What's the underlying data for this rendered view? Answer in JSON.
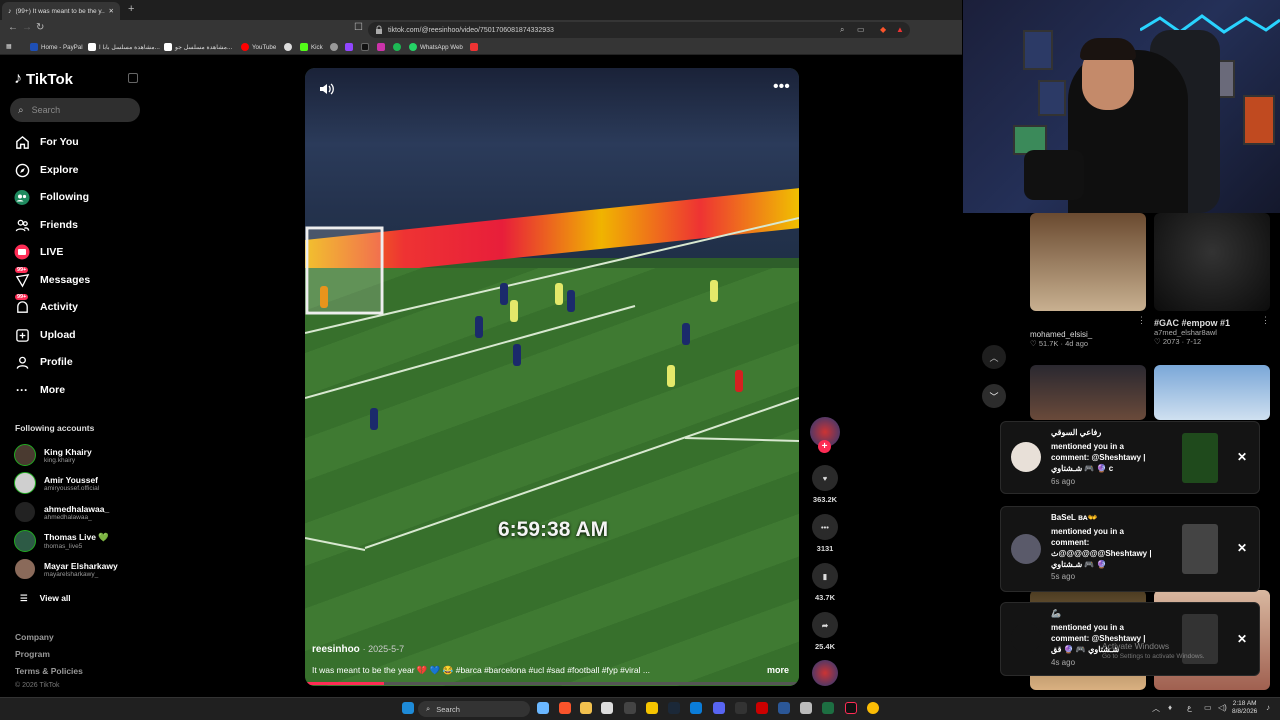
{
  "browser": {
    "tab_title": "(99+) It was meant to be the y...",
    "new_tab": "+",
    "url": "tiktok.com/@reesinhoo/video/7501706081874332933",
    "bookmarks": [
      {
        "label": "Home - PayPal",
        "color": "#1e4fb5"
      },
      {
        "label": "مشاهدة مسلسل بابا ا...",
        "color": "#ffffff"
      },
      {
        "label": "مشاهدة مسلسل جو...",
        "color": "#ffffff"
      },
      {
        "label": "YouTube",
        "color": "#ff0000"
      },
      {
        "label": "Kick",
        "color": "#53fc18"
      },
      {
        "label": "WhatsApp Web",
        "color": "#25d366"
      }
    ]
  },
  "sidebar": {
    "logo": "TikTok",
    "search_placeholder": "Search",
    "nav": [
      {
        "label": "For You",
        "icon": "home-icon"
      },
      {
        "label": "Explore",
        "icon": "compass-icon"
      },
      {
        "label": "Following",
        "icon": "following-icon"
      },
      {
        "label": "Friends",
        "icon": "friends-icon"
      },
      {
        "label": "LIVE",
        "icon": "live-icon"
      },
      {
        "label": "Messages",
        "icon": "messages-icon",
        "badge": "99+"
      },
      {
        "label": "Activity",
        "icon": "activity-icon",
        "badge": "99+"
      },
      {
        "label": "Upload",
        "icon": "upload-icon"
      },
      {
        "label": "Profile",
        "icon": "profile-icon"
      },
      {
        "label": "More",
        "icon": "more-icon"
      }
    ],
    "following_title": "Following accounts",
    "accounts": [
      {
        "name": "King Khairy",
        "handle": "king.khairy"
      },
      {
        "name": "Amir Youssef",
        "handle": "amiryoussef.official"
      },
      {
        "name": "ahmedhalawaa_",
        "handle": "ahmedhalawaa_"
      },
      {
        "name": "Thomas Live 💚",
        "handle": "thomas_live5"
      },
      {
        "name": "Mayar Elsharkawy",
        "handle": "mayarelsharkawy_"
      }
    ],
    "view_all": "View all",
    "footer_links": [
      "Company",
      "Program",
      "Terms & Policies"
    ],
    "copyright": "© 2026 TikTok"
  },
  "video": {
    "time_overlay": "6:59:38 AM",
    "author": "reesinhoo",
    "date": "· 2025-5-7",
    "caption": "It was meant to be the year 💔 💙 😂 #barca #barcelona #ucl #sad #football #fyp #viral ...",
    "more": "more",
    "progress_fraction": 0.16
  },
  "actions": {
    "likes": "363.2K",
    "comments": "3131",
    "saves": "43.7K",
    "shares": "25.4K"
  },
  "feed": [
    {
      "title": "mohamed_elsisi_",
      "likes": "51.7K",
      "age": "4d ago"
    },
    {
      "title": "#GAC #empow #1",
      "author": "a7med_elshar8awl",
      "likes": "2073",
      "age": "7-12"
    }
  ],
  "notifications": [
    {
      "name": "رفاعي السوقي",
      "text": "mentioned you in a comment: @Sheshtawy | شـشتاوي 🎮 🔮 c",
      "time": "6s ago"
    },
    {
      "name": "BaSeL ʙᴀ👐",
      "text": "mentioned you in a comment: ث@@@@@@Sheshtawy | شـشتاوي 🎮 🔮",
      "time": "5s ago"
    },
    {
      "name": "🦾",
      "text": "mentioned you in a comment: @Sheshtawy | شـشتاوي 🎮 🔮 قق",
      "time": "4s ago"
    }
  ],
  "windows_watermark": {
    "line1": "Activate Windows",
    "line2": "Go to Settings to activate Windows."
  },
  "taskbar": {
    "search": "Search",
    "time": "2:18 AM",
    "date": "8/8/2026",
    "lang": "ع"
  },
  "colors": {
    "accent": "#fe2c55",
    "bg": "#000000"
  }
}
